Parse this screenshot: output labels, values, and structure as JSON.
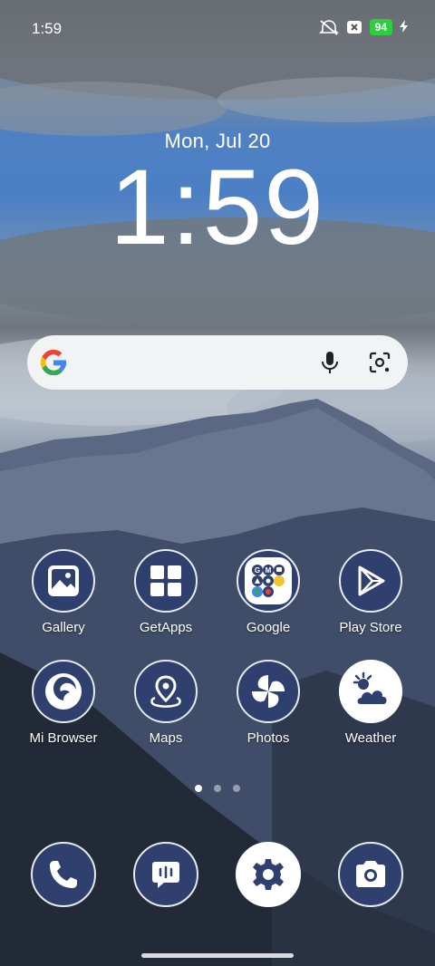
{
  "status_bar": {
    "time": "1:59",
    "battery": "94",
    "icons": [
      "mute-icon",
      "sim-icon",
      "battery-icon",
      "charging-icon"
    ]
  },
  "lockscreen": {
    "date": "Mon, Jul 20",
    "time": "1:59"
  },
  "search": {
    "icons": [
      "google-logo-icon",
      "mic-icon",
      "lens-icon"
    ]
  },
  "apps": [
    {
      "label": "Gallery",
      "icon": "gallery-icon"
    },
    {
      "label": "GetApps",
      "icon": "getapps-icon"
    },
    {
      "label": "Google",
      "icon": "google-folder-icon"
    },
    {
      "label": "Play Store",
      "icon": "play-store-icon"
    },
    {
      "label": "Mi Browser",
      "icon": "mi-browser-icon"
    },
    {
      "label": "Maps",
      "icon": "maps-icon"
    },
    {
      "label": "Photos",
      "icon": "photos-icon"
    },
    {
      "label": "Weather",
      "icon": "weather-icon"
    }
  ],
  "page_indicator": {
    "pages": 3,
    "active": 1
  },
  "dock": [
    {
      "icon": "phone-icon"
    },
    {
      "icon": "messages-icon"
    },
    {
      "icon": "settings-icon"
    },
    {
      "icon": "camera-icon"
    }
  ],
  "colors": {
    "icon_fill": "#2f3f6e",
    "icon_ring": "#e6e9f0",
    "battery": "#2fce41"
  }
}
